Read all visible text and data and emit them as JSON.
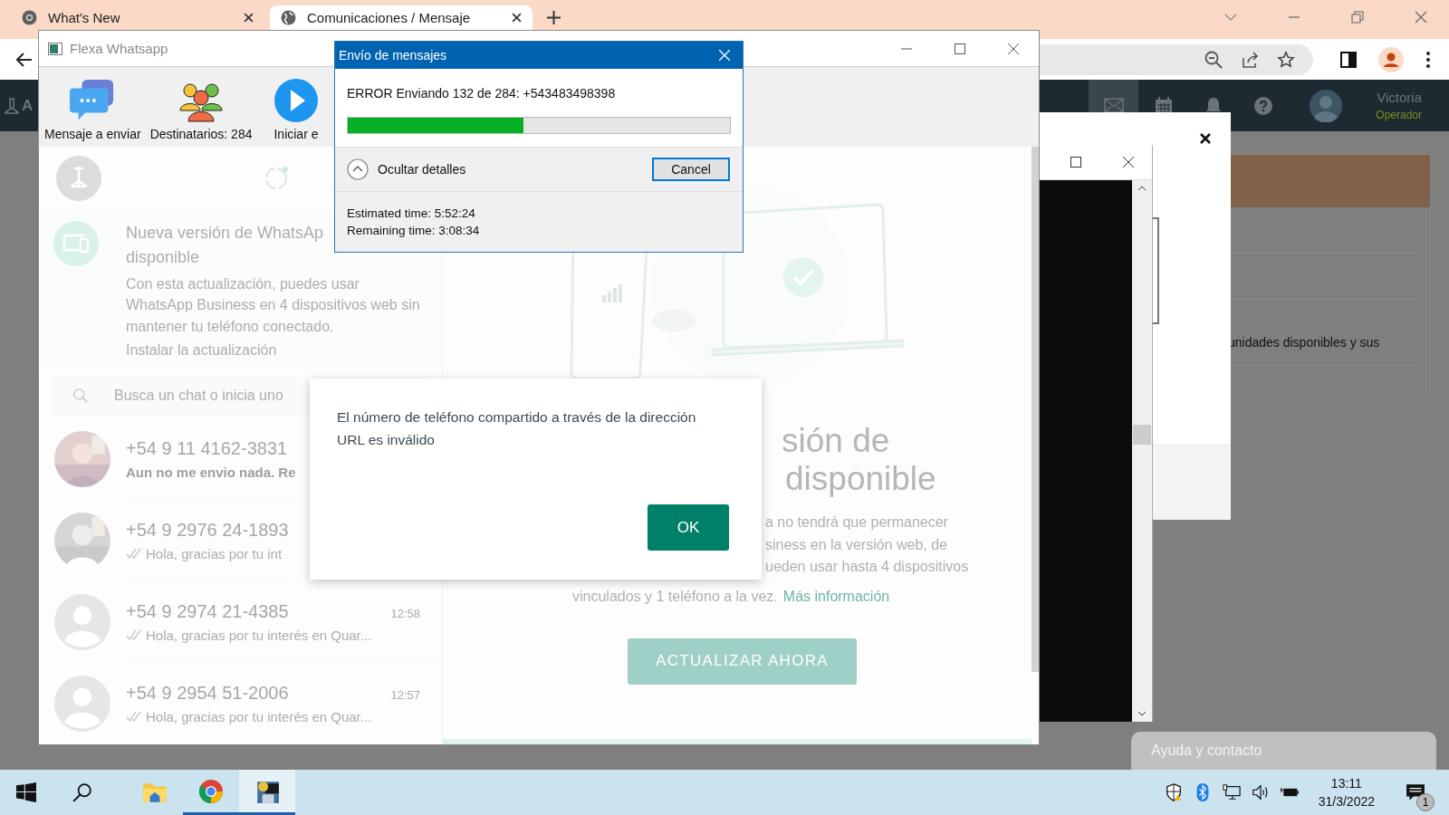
{
  "browser": {
    "tabs": [
      {
        "title": "What's New",
        "selected": false
      },
      {
        "title": "Comunicaciones / Mensaje",
        "selected": true
      }
    ]
  },
  "site": {
    "logo": "A",
    "nav": [
      {
        "selected": true
      },
      {
        "selected": false
      },
      {
        "selected": false
      },
      {
        "selected": false
      }
    ],
    "user": {
      "name": "Victoria",
      "role": "Operador"
    },
    "snippet": "unidades disponibles y sus",
    "help_button": "Ayuda y contacto"
  },
  "flexa": {
    "title": "Flexa Whatsapp",
    "toolbar": [
      {
        "label": "Mensaje a enviar"
      },
      {
        "label": "Destinatarios: 284"
      },
      {
        "label": "Iniciar e"
      }
    ]
  },
  "whatsapp": {
    "banner": {
      "title_lines": [
        "Nueva versión de WhatsAp",
        "disponible"
      ],
      "body": "Con esta actualización, puedes usar WhatsApp Business en 4 dispositivos web sin mantener tu teléfono conectado.",
      "link": "Instalar la actualización"
    },
    "search": {
      "placeholder": "Busca un chat o inicia uno"
    },
    "chats": [
      {
        "name": "+54 9 11 4162-3831",
        "message": "Aun no me envio nada. Re",
        "unread": true,
        "ticks": false
      },
      {
        "name": "+54 9 2976 24-1893",
        "message": "Hola, gracias por tu int",
        "unread": false,
        "ticks": true
      },
      {
        "name": "+54 9 2974 21-4385",
        "time": "12:58",
        "message": "Hola, gracias por tu interés en Quar...",
        "kind": "default",
        "unread": false,
        "ticks": true
      },
      {
        "name": "+54 9 2954 51-2006",
        "time": "12:57",
        "message": "Hola, gracias por tu interés en Quar...",
        "kind": "default",
        "unread": false,
        "ticks": true
      }
    ],
    "intro": {
      "title_lines": [
        "sión de",
        "disponible"
      ],
      "body_lines": [
        "a no tendrá que permanecer",
        "siness en la versión web, de",
        "ueden usar hasta 4 dispositivos"
      ],
      "last_line": "vinculados y 1 teléfono a la vez.",
      "link": "Más información",
      "button": "ACTUALIZAR AHORA"
    }
  },
  "progress_dialog": {
    "title": "Envío de mensajes",
    "status": "ERROR Enviando 132 de 284: +543483498398",
    "level": 0.46,
    "details_toggle": "Ocultar detalles",
    "expanded": true,
    "cancel": "Cancel",
    "details": [
      "Estimated time: 5:52:24",
      "Remaining time: 3:08:34"
    ]
  },
  "alert": {
    "message": "El número de teléfono compartido a través de la dirección URL es inválido",
    "button": "OK"
  },
  "taskbar": {
    "apps": [
      {
        "running": false,
        "active": false
      },
      {
        "running": true,
        "active": false
      },
      {
        "running": true,
        "active": true
      }
    ],
    "time": "13:11",
    "date": "31/3/2022",
    "notifications": "1"
  }
}
